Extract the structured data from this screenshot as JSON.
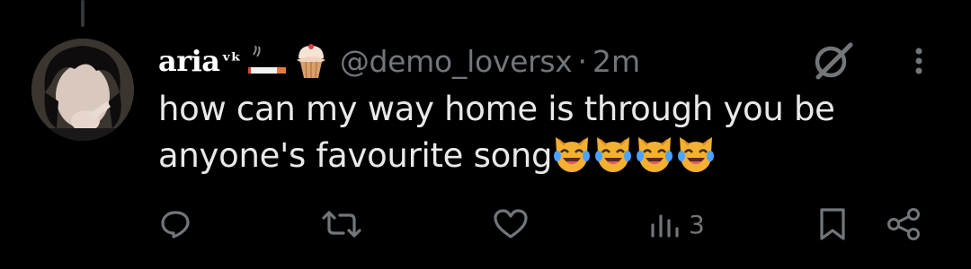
{
  "colors": {
    "background": "#000000",
    "text_primary": "#e7e9ea",
    "text_secondary": "#71767b",
    "thread_line": "#333639"
  },
  "tweet": {
    "display_name": "aria",
    "display_name_decor": "ᵛᵏ",
    "name_emojis": [
      "cigarette-emoji",
      "cupcake-emoji"
    ],
    "handle": "@demo_loversx",
    "separator": "·",
    "time": "2m",
    "text": "how can my way home is through you be anyone's favourite song",
    "trailing_emojis": [
      "cat-tears-of-joy",
      "cat-tears-of-joy",
      "cat-tears-of-joy",
      "cat-tears-of-joy"
    ]
  },
  "actions": {
    "reply_icon": "reply-icon",
    "retweet_icon": "retweet-icon",
    "like_icon": "like-icon",
    "views_icon": "views-icon",
    "views_count": "3",
    "bookmark_icon": "bookmark-icon",
    "share_icon": "share-icon"
  }
}
